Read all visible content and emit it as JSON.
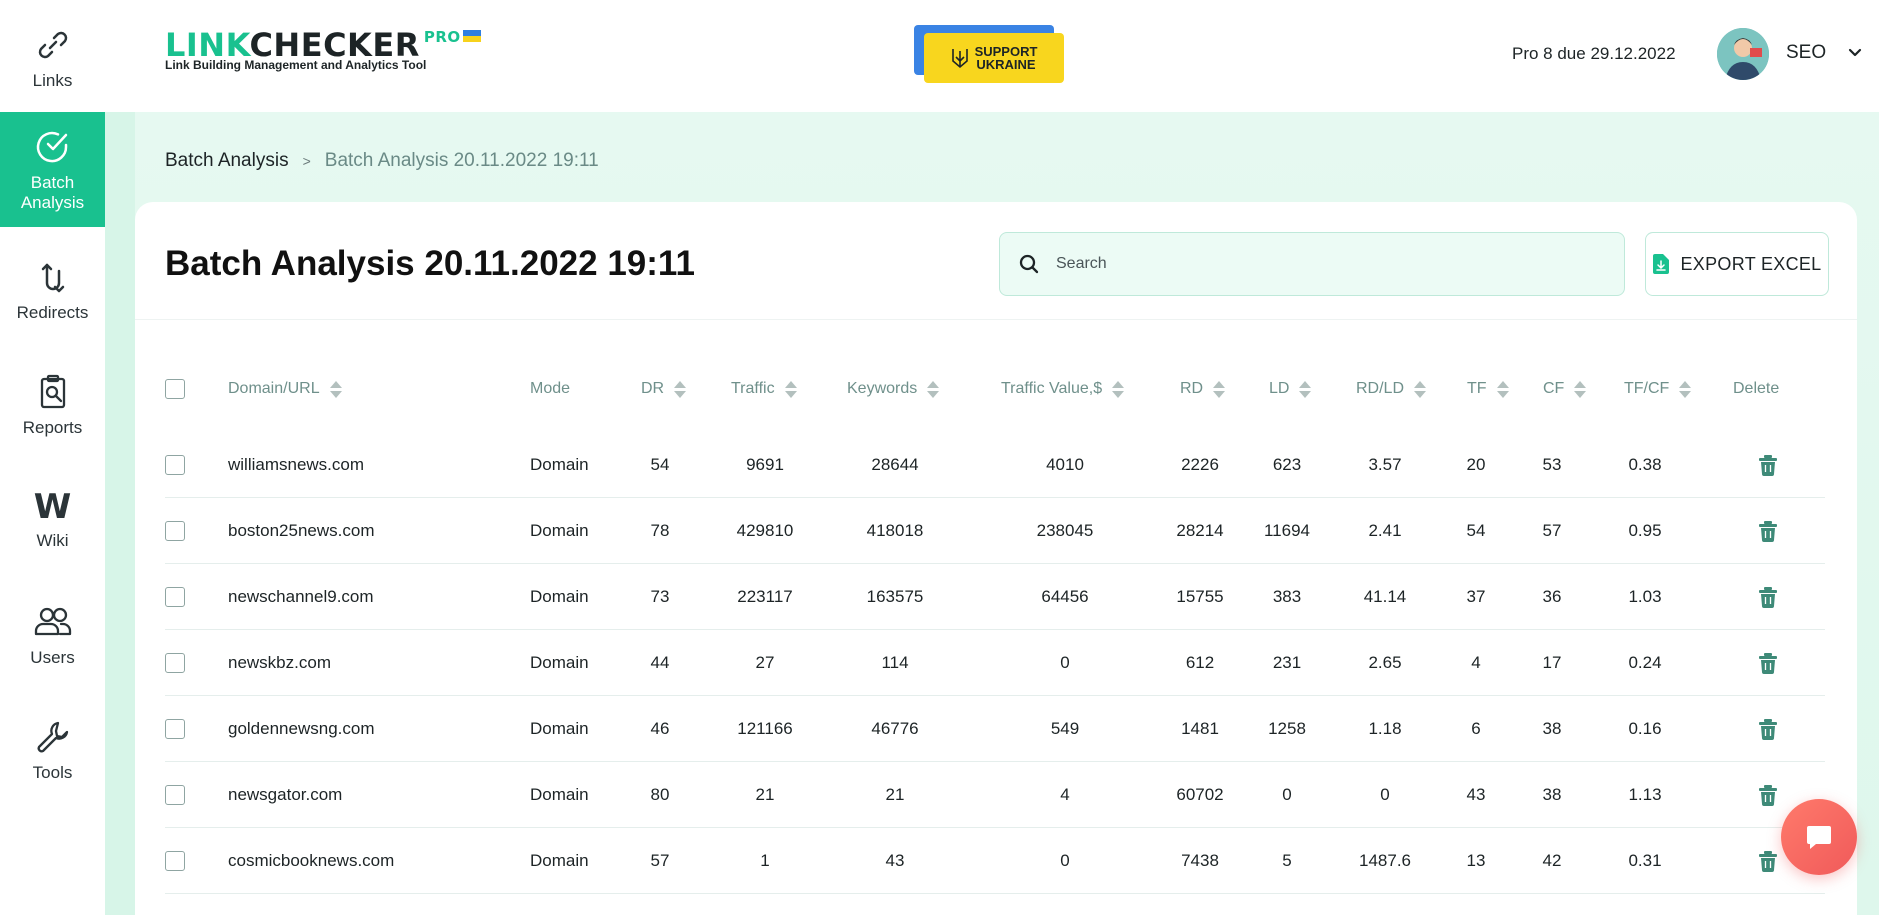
{
  "sidebar": {
    "items": [
      {
        "label": "Links",
        "icon": "link-icon"
      },
      {
        "label": "Batch",
        "label2": "Analysis",
        "icon": "check-circle-icon",
        "active": true
      },
      {
        "label": "Redirects",
        "icon": "redirect-icon"
      },
      {
        "label": "Reports",
        "icon": "report-icon"
      },
      {
        "label": "Wiki",
        "glyph": "W",
        "icon": "wiki-icon"
      },
      {
        "label": "Users",
        "icon": "users-icon"
      },
      {
        "label": "Tools",
        "icon": "wrench-icon"
      }
    ]
  },
  "header": {
    "logo_link": "LINK",
    "logo_checker": "CHECKER",
    "logo_pro": "PRO",
    "logo_tagline": "Link Building Management and Analytics Tool",
    "support_line1": "SUPPORT",
    "support_line2": "UKRAINE",
    "plan": "Pro 8 due 29.12.2022",
    "user_name": "SEO"
  },
  "breadcrumb": {
    "root": "Batch Analysis",
    "separator": ">",
    "current": "Batch Analysis 20.11.2022 19:11"
  },
  "page": {
    "title": "Batch Analysis 20.11.2022 19:11",
    "search_placeholder": "Search",
    "export_label": "EXPORT EXCEL"
  },
  "table": {
    "columns": [
      "Domain/URL",
      "Mode",
      "DR",
      "Traffic",
      "Keywords",
      "Traffic Value,$",
      "RD",
      "LD",
      "RD/LD",
      "TF",
      "CF",
      "TF/CF",
      "Delete"
    ],
    "rows": [
      {
        "domain": "williamsnews.com",
        "mode": "Domain",
        "dr": "54",
        "traffic": "9691",
        "keywords": "28644",
        "traffic_value": "4010",
        "rd": "2226",
        "ld": "623",
        "rd_ld": "3.57",
        "tf": "20",
        "cf": "53",
        "tf_cf": "0.38"
      },
      {
        "domain": "boston25news.com",
        "mode": "Domain",
        "dr": "78",
        "traffic": "429810",
        "keywords": "418018",
        "traffic_value": "238045",
        "rd": "28214",
        "ld": "11694",
        "rd_ld": "2.41",
        "tf": "54",
        "cf": "57",
        "tf_cf": "0.95"
      },
      {
        "domain": "newschannel9.com",
        "mode": "Domain",
        "dr": "73",
        "traffic": "223117",
        "keywords": "163575",
        "traffic_value": "64456",
        "rd": "15755",
        "ld": "383",
        "rd_ld": "41.14",
        "tf": "37",
        "cf": "36",
        "tf_cf": "1.03"
      },
      {
        "domain": "newskbz.com",
        "mode": "Domain",
        "dr": "44",
        "traffic": "27",
        "keywords": "114",
        "traffic_value": "0",
        "rd": "612",
        "ld": "231",
        "rd_ld": "2.65",
        "tf": "4",
        "cf": "17",
        "tf_cf": "0.24"
      },
      {
        "domain": "goldennewsng.com",
        "mode": "Domain",
        "dr": "46",
        "traffic": "121166",
        "keywords": "46776",
        "traffic_value": "549",
        "rd": "1481",
        "ld": "1258",
        "rd_ld": "1.18",
        "tf": "6",
        "cf": "38",
        "tf_cf": "0.16"
      },
      {
        "domain": "newsgator.com",
        "mode": "Domain",
        "dr": "80",
        "traffic": "21",
        "keywords": "21",
        "traffic_value": "4",
        "rd": "60702",
        "ld": "0",
        "rd_ld": "0",
        "tf": "43",
        "cf": "38",
        "tf_cf": "1.13"
      },
      {
        "domain": "cosmicbooknews.com",
        "mode": "Domain",
        "dr": "57",
        "traffic": "1",
        "keywords": "43",
        "traffic_value": "0",
        "rd": "7438",
        "ld": "5",
        "rd_ld": "1487.6",
        "tf": "13",
        "cf": "42",
        "tf_cf": "0.31"
      }
    ]
  },
  "colors": {
    "accent": "#19c18f",
    "header_text": "#6f908b",
    "trash": "#3e8a78",
    "chat": "#f05a5a"
  }
}
